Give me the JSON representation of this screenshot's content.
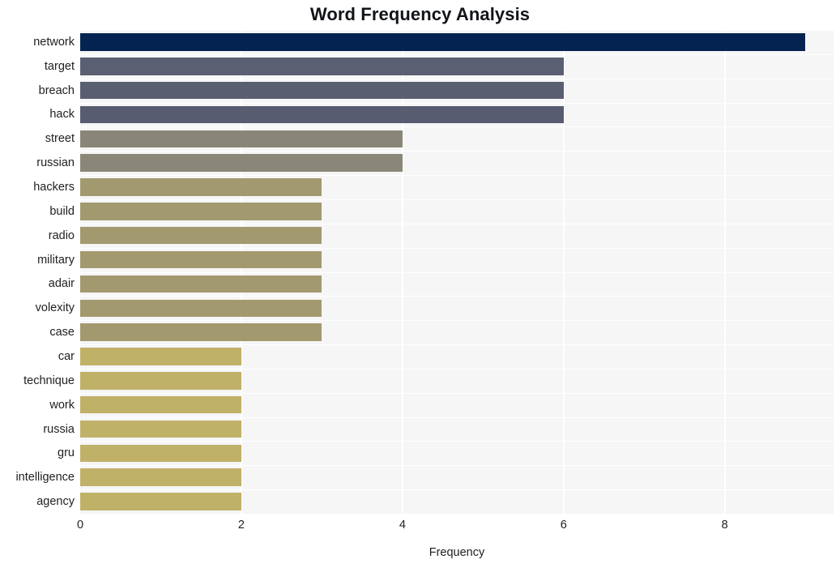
{
  "chart_data": {
    "type": "bar",
    "orientation": "horizontal",
    "title": "Word Frequency Analysis",
    "xlabel": "Frequency",
    "ylabel": "",
    "xlim": [
      0,
      9.35
    ],
    "ylim": null,
    "grid": true,
    "legend": null,
    "xticks": [
      "0",
      "2",
      "4",
      "6",
      "8"
    ],
    "xtick_values": [
      0,
      2,
      4,
      6,
      8
    ],
    "categories": [
      "network",
      "target",
      "breach",
      "hack",
      "street",
      "russian",
      "hackers",
      "build",
      "radio",
      "military",
      "adair",
      "volexity",
      "case",
      "car",
      "technique",
      "work",
      "russia",
      "gru",
      "intelligence",
      "agency"
    ],
    "values": [
      9,
      6,
      6,
      6,
      4,
      4,
      3,
      3,
      3,
      3,
      3,
      3,
      3,
      2,
      2,
      2,
      2,
      2,
      2,
      2
    ],
    "bar_colors": [
      "#042350",
      "#5a5f72",
      "#595e71",
      "#575c70",
      "#8a8677",
      "#8b8778",
      "#a2996f",
      "#a2996f",
      "#a3996f",
      "#a3996f",
      "#a3996f",
      "#a3996f",
      "#a3996f",
      "#c0b168",
      "#c0b168",
      "#c0b168",
      "#c0b168",
      "#c0b168",
      "#c0b168",
      "#c0b168"
    ],
    "plot_background": "#f6f6f7",
    "figure_background": "#ffffff",
    "gridline_color": "#ffffff"
  }
}
